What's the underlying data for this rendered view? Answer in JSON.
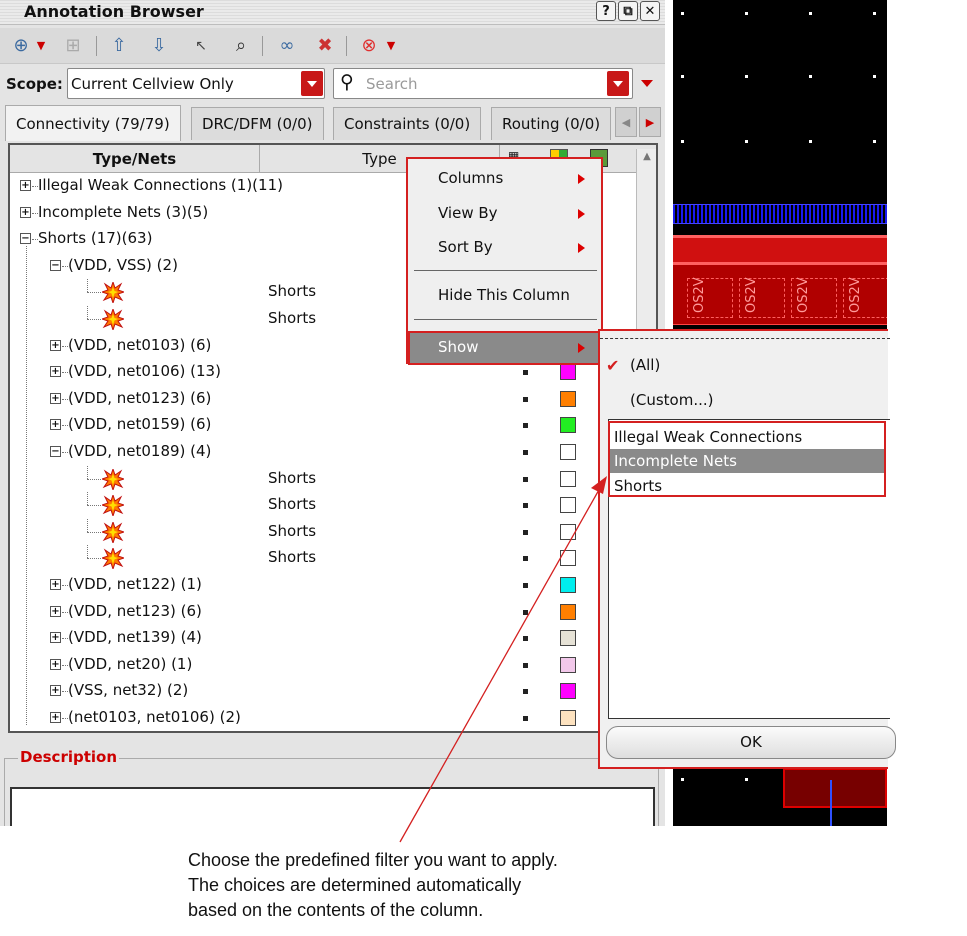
{
  "window": {
    "title": "Annotation Browser",
    "help_btn": "?",
    "restore_btn": "⧉",
    "close_btn": "✕"
  },
  "toolbar": {
    "icons": [
      "zoom-fit-icon",
      "dropdown-icon",
      "zoom-select-icon",
      "up-arrow-icon",
      "down-arrow-icon",
      "pointer-icon",
      "magnify-icon",
      "link-icon",
      "unlink-icon",
      "stop-icon",
      "dropdown-icon"
    ]
  },
  "scope": {
    "label": "Scope:",
    "value": "Current Cellview Only"
  },
  "search": {
    "placeholder": "Search"
  },
  "tabs": [
    "Connectivity (79/79)",
    "DRC/DFM (0/0)",
    "Constraints (0/0)",
    "Routing (0/0)"
  ],
  "tree": {
    "headers": {
      "type_nets": "Type/Nets",
      "type": "Type"
    },
    "rows": [
      {
        "label": "Illegal Weak Connections (1)(11)",
        "level": 0,
        "exp": "+"
      },
      {
        "label": "Incomplete Nets (3)(5)",
        "level": 0,
        "exp": "+"
      },
      {
        "label": "Shorts (17)(63)",
        "level": 0,
        "exp": "-"
      },
      {
        "label": "(VDD, VSS) (2)",
        "level": 1,
        "exp": "-"
      },
      {
        "label": "",
        "level": 2,
        "type": "Shorts",
        "icon": "short-marker-icon"
      },
      {
        "label": "",
        "level": 2,
        "type": "Shorts",
        "icon": "short-marker-icon"
      },
      {
        "label": "(VDD, net0103) (6)",
        "level": 1,
        "exp": "+"
      },
      {
        "label": "(VDD, net0106) (13)",
        "level": 1,
        "exp": "+",
        "color": "#ff00ff"
      },
      {
        "label": "(VDD, net0123) (6)",
        "level": 1,
        "exp": "+",
        "color": "#ff7f00"
      },
      {
        "label": "(VDD, net0159) (6)",
        "level": 1,
        "exp": "+",
        "color": "#22ee22"
      },
      {
        "label": "(VDD, net0189) (4)",
        "level": 1,
        "exp": "-",
        "color": "#ffffff"
      },
      {
        "label": "",
        "level": 2,
        "type": "Shorts",
        "icon": "short-marker-icon",
        "color": "#ffffff"
      },
      {
        "label": "",
        "level": 2,
        "type": "Shorts",
        "icon": "short-marker-icon",
        "color": "#ffffff"
      },
      {
        "label": "",
        "level": 2,
        "type": "Shorts",
        "icon": "short-marker-icon",
        "color": "#ffffff"
      },
      {
        "label": "",
        "level": 2,
        "type": "Shorts",
        "icon": "short-marker-icon",
        "color": "#ffffff"
      },
      {
        "label": "(VDD, net122) (1)",
        "level": 1,
        "exp": "+",
        "color": "#00eeee"
      },
      {
        "label": "(VDD, net123) (6)",
        "level": 1,
        "exp": "+",
        "color": "#ff7f00"
      },
      {
        "label": "(VDD, net139) (4)",
        "level": 1,
        "exp": "+",
        "color": "#e6e2d6"
      },
      {
        "label": "(VDD, net20) (1)",
        "level": 1,
        "exp": "+",
        "color": "#f2c8ea"
      },
      {
        "label": "(VSS, net32) (2)",
        "level": 1,
        "exp": "+",
        "color": "#ff00ff"
      },
      {
        "label": "(net0103, net0106) (2)",
        "level": 1,
        "exp": "+",
        "color": "#fde2bf"
      }
    ]
  },
  "description": {
    "label": "Description"
  },
  "context_menu": {
    "columns": "Columns",
    "view_by": "View By",
    "sort_by": "Sort By",
    "hide_column": "Hide This Column",
    "show": "Show"
  },
  "show_submenu": {
    "all": "(All)",
    "custom": "(Custom...)",
    "filters": [
      "Illegal Weak Connections",
      "Incomplete Nets",
      "Shorts"
    ],
    "selected_filter": "Incomplete Nets",
    "ok": "OK"
  },
  "callout": {
    "line1": "Choose the predefined filter you want to apply.",
    "line2": "The choices are determined automatically",
    "line3": "based on the contents of the column."
  },
  "layout_view": {
    "labels": [
      "OS2V",
      "OS2V",
      "OS2V",
      "OS2V"
    ]
  },
  "colors": {
    "accent_red": "#d42020",
    "highlight_gray": "#8a8a8a"
  }
}
